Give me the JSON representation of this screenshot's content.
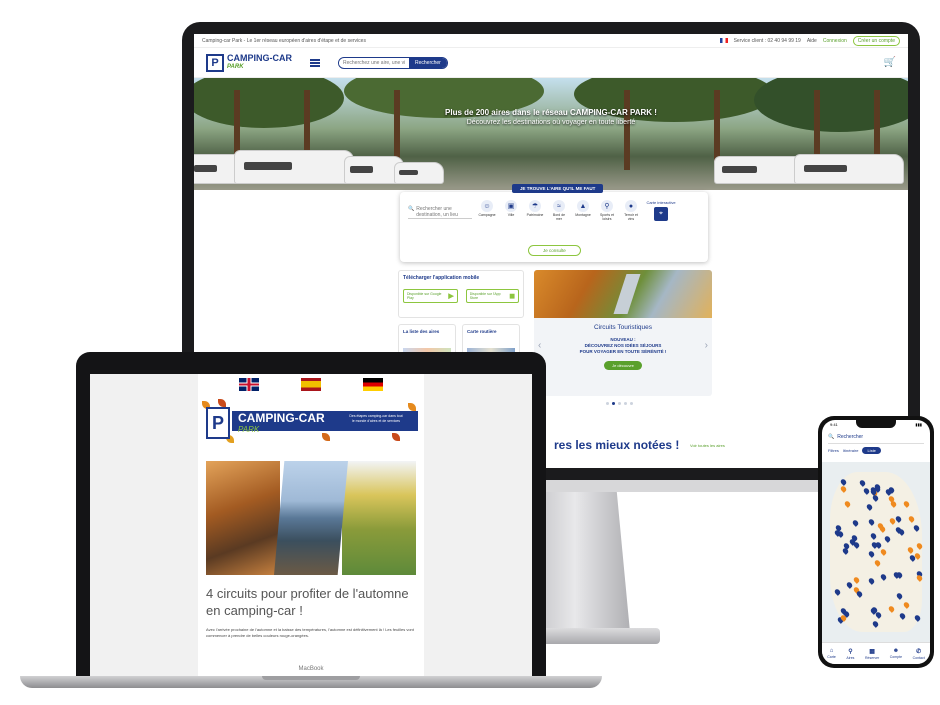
{
  "imac": {
    "top_strip": {
      "left_text": "Camping-car Park - Le 1er réseau européen d'aires d'étape et de services",
      "phone_text": "Service client : 02 40 94 99 19",
      "help": "Aide",
      "account_label": "Connexion",
      "signup_label": "Créer un compte"
    },
    "logo": {
      "name": "CAMPING-CAR",
      "sub": "PARK"
    },
    "search": {
      "placeholder": "Recherchez une aire, une ville",
      "button": "Rechercher"
    },
    "hero": {
      "headline": "Plus de 200 aires dans le réseau CAMPING-CAR PARK !",
      "subline": "Découvrez les destinations où voyager en toute liberté"
    },
    "finder": {
      "tab_label": "JE TROUVE L'AIRE QU'IL ME FAUT",
      "input_placeholder": "Rechercher une destination, un lieu",
      "categories": [
        {
          "icon": "person-icon",
          "label": "Campagne"
        },
        {
          "icon": "city-icon",
          "label": "Ville"
        },
        {
          "icon": "beach-icon",
          "label": "Patrimoine"
        },
        {
          "icon": "lake-icon",
          "label": "Bord de mer"
        },
        {
          "icon": "mountain-icon",
          "label": "Montagne"
        },
        {
          "icon": "bike-icon",
          "label": "Sports et loisirs"
        },
        {
          "icon": "drop-icon",
          "label": "Terroir et vins"
        }
      ],
      "map_label": "Carte interactive",
      "submit": "Je consulte"
    },
    "app_box": {
      "title": "Télécharger l'application mobile",
      "google": "Disponible sur Google Play",
      "apple": "Disponible sur l'App Store"
    },
    "mini_boxes": [
      "La liste des aires",
      "Carte routière"
    ],
    "circuits": {
      "title": "Circuits Touristiques",
      "body_1": "NOUVEAU :",
      "body_2": "DÉCOUVREZ NOS IDÉES SÉJOURS",
      "body_3": "POUR VOYAGER EN TOUTE SÉRÉNITÉ !",
      "button": "Je découvre"
    },
    "best_rated": {
      "title": "res les mieux notées !",
      "link": "Voir toutes les aires"
    }
  },
  "macbook": {
    "label": "MacBook",
    "newsletter": {
      "brand": "CAMPING-CAR",
      "brand_sub": "PARK",
      "tagline": "Des étapes camping-car dans tout le monde d'aires et de services",
      "headline": "4 circuits pour profiter de l'automne en camping-car !",
      "body": "Avec l'arrivée prochaine de l'automne et la baisse des températures, l'automne est définitivement là ! Les feuilles vont commencer à prendre de belles couleurs rouge-orangées."
    }
  },
  "phone": {
    "time": "9:41",
    "search_label": "Rechercher",
    "filters": [
      "Filtres",
      "Itinéraire"
    ],
    "active_filter": "Liste",
    "tabs": [
      "Carte",
      "Aires",
      "Réserver",
      "Compte",
      "Contact"
    ]
  },
  "colors": {
    "brand_blue": "#1e3a8a",
    "brand_green": "#5aa02c",
    "pin_orange": "#ef8a1f"
  }
}
